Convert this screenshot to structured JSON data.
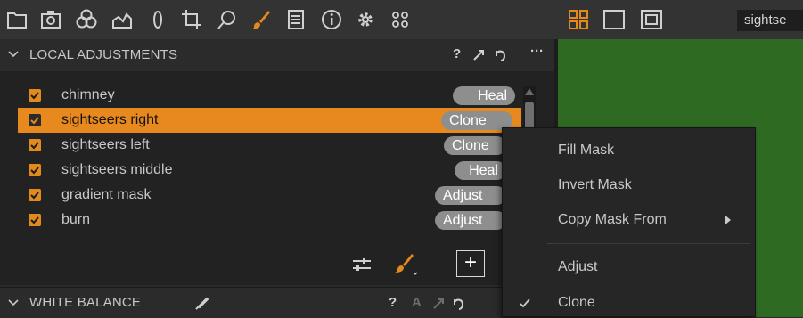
{
  "toolbar": {
    "tools": [
      "folder-icon",
      "camera-icon",
      "color-circles-icon",
      "levels-icon",
      "lens-icon",
      "crop-icon",
      "spot-icon",
      "brush-icon",
      "list-icon",
      "info-icon",
      "settings-icon",
      "scripts-icon"
    ],
    "active_tool": "brush-icon",
    "accent": "#e38a1c"
  },
  "viewer": {
    "layout_icons": [
      "grid-layout-icon",
      "single-layout-icon",
      "compare-layout-icon"
    ],
    "name_field": "sightse",
    "bg_color": "#2f6a23"
  },
  "local_adjustments": {
    "title": "LOCAL ADJUSTMENTS",
    "help": "?",
    "more": "···",
    "layers": [
      {
        "name": "chimney",
        "mode": "Heal",
        "checked": true,
        "selected": false
      },
      {
        "name": "sightseers right",
        "mode": "Clone",
        "checked": true,
        "selected": true
      },
      {
        "name": "sightseers left",
        "mode": "Clone",
        "checked": true,
        "selected": false
      },
      {
        "name": "sightseers middle",
        "mode": "Heal",
        "checked": true,
        "selected": false
      },
      {
        "name": "gradient mask",
        "mode": "Adjust",
        "checked": true,
        "selected": false
      },
      {
        "name": "burn",
        "mode": "Adjust",
        "checked": true,
        "selected": false
      }
    ],
    "add_label": "+"
  },
  "white_balance": {
    "title": "WHITE BALANCE",
    "help": "?",
    "auto": "A"
  },
  "context_menu": {
    "items": [
      {
        "label": "Fill Mask"
      },
      {
        "label": "Invert Mask"
      },
      {
        "label": "Copy Mask From"
      },
      {
        "label": "Adjust"
      },
      {
        "label": "Clone",
        "checked": true
      }
    ]
  }
}
